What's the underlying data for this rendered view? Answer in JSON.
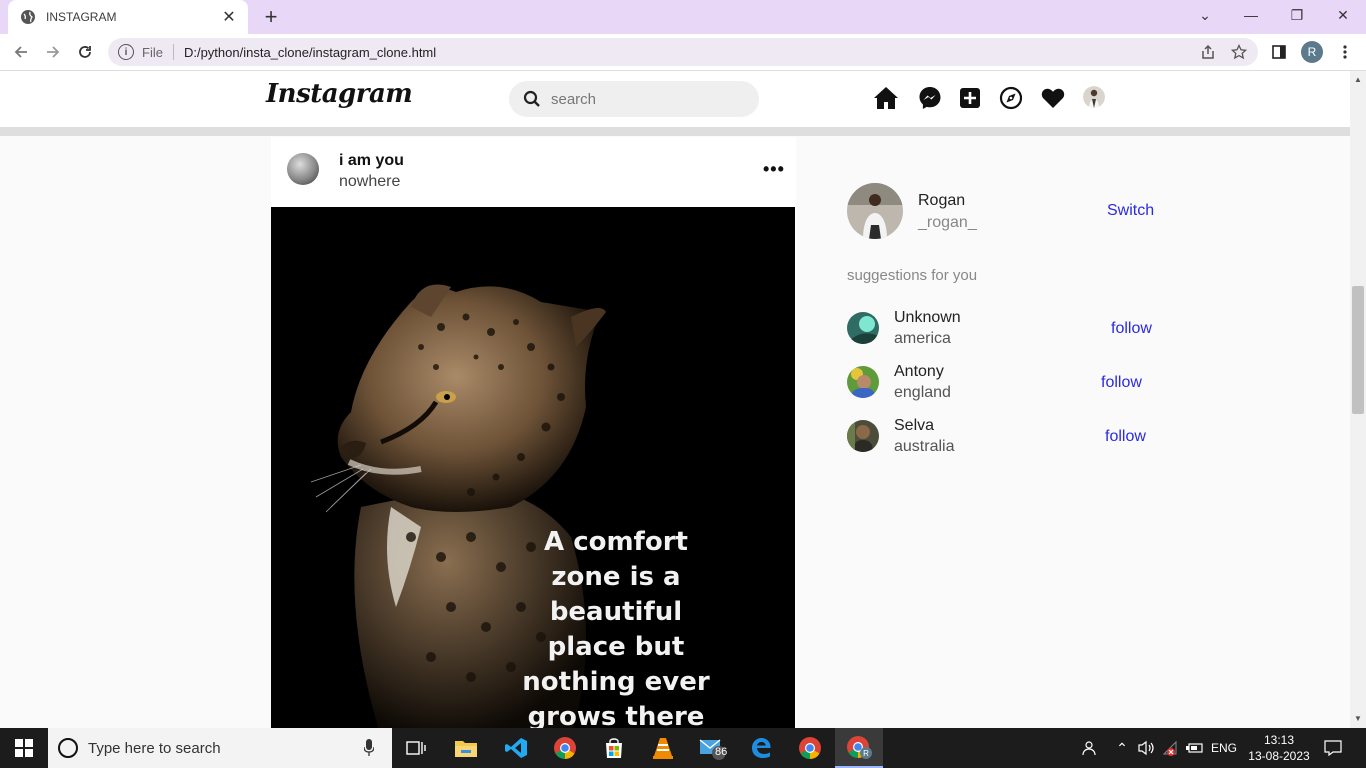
{
  "browser": {
    "tab_title": "INSTAGRAM",
    "tab_close": "✕",
    "new_tab": "+",
    "url_scheme_label": "File",
    "url": "D:/python/insta_clone/instagram_clone.html",
    "profile_initial": "R",
    "window_controls": {
      "collapse": "⌄",
      "minimize": "—",
      "restore": "❐",
      "close": "✕"
    }
  },
  "header": {
    "logo": "Instagram",
    "search_placeholder": "search",
    "nav_icons": [
      "home-icon",
      "messenger-icon",
      "add-post-icon",
      "explore-icon",
      "heart-icon",
      "profile-avatar"
    ]
  },
  "post": {
    "username": "i am you",
    "location": "nowhere",
    "more": "•••",
    "quote_lines": [
      "A comfort",
      "zone is a",
      "beautiful",
      "place but",
      "nothing ever",
      "grows there"
    ]
  },
  "sidebar": {
    "me": {
      "name": "Rogan",
      "handle": "_rogan_",
      "switch_label": "Switch"
    },
    "suggestions_title": "suggestions for you",
    "suggestions": [
      {
        "name": "Unknown",
        "location": "america",
        "action": "follow"
      },
      {
        "name": "Antony",
        "location": "england",
        "action": "follow"
      },
      {
        "name": "Selva",
        "location": "australia",
        "action": "follow"
      }
    ]
  },
  "taskbar": {
    "search_placeholder": "Type here to search",
    "mail_badge": "86",
    "language": "ENG",
    "time": "13:13",
    "date": "13-08-2023"
  },
  "colors": {
    "link_blue": "#2a2ae0",
    "tabstrip": "#e8d7f7",
    "taskbar": "#1c1c1c"
  }
}
